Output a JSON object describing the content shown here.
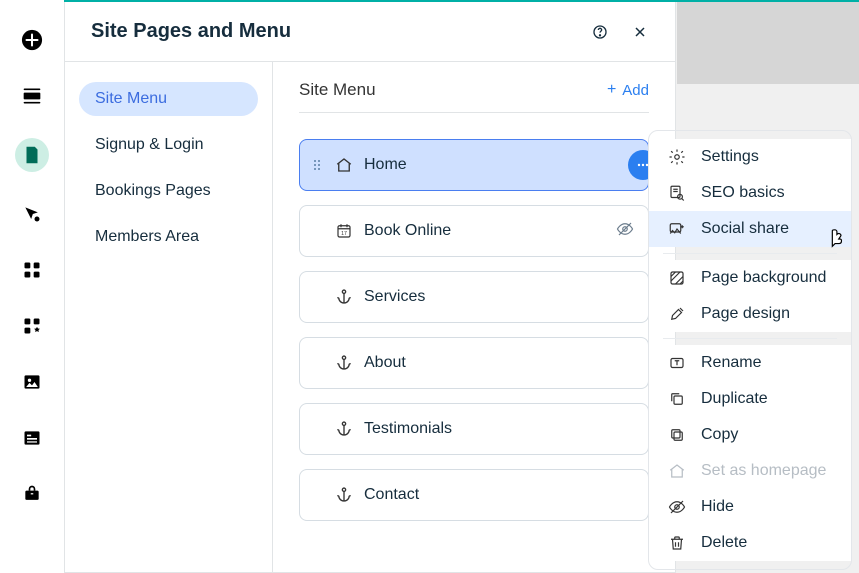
{
  "panel": {
    "title": "Site Pages and Menu"
  },
  "sidebar": {
    "items": [
      {
        "label": "Site Menu",
        "active": true
      },
      {
        "label": "Signup & Login"
      },
      {
        "label": "Bookings Pages"
      },
      {
        "label": "Members Area"
      }
    ]
  },
  "main": {
    "title": "Site Menu",
    "add_label": "Add",
    "pages": [
      {
        "label": "Home",
        "icon": "home",
        "selected": true
      },
      {
        "label": "Book Online",
        "icon": "calendar",
        "hidden_icon": true
      },
      {
        "label": "Services",
        "icon": "anchor"
      },
      {
        "label": "About",
        "icon": "anchor"
      },
      {
        "label": "Testimonials",
        "icon": "anchor"
      },
      {
        "label": "Contact",
        "icon": "anchor"
      }
    ]
  },
  "context_menu": {
    "items": [
      {
        "label": "Settings",
        "icon": "gear"
      },
      {
        "label": "SEO basics",
        "icon": "search-doc"
      },
      {
        "label": "Social share",
        "icon": "share-card",
        "highlight": true
      },
      {
        "divider": true
      },
      {
        "label": "Page background",
        "icon": "diag"
      },
      {
        "label": "Page design",
        "icon": "brush"
      },
      {
        "divider": true
      },
      {
        "label": "Rename",
        "icon": "text-box"
      },
      {
        "label": "Duplicate",
        "icon": "duplicate"
      },
      {
        "label": "Copy",
        "icon": "copy"
      },
      {
        "label": "Set as homepage",
        "icon": "home-small",
        "disabled": true
      },
      {
        "label": "Hide",
        "icon": "eye-off"
      },
      {
        "label": "Delete",
        "icon": "trash"
      }
    ]
  }
}
